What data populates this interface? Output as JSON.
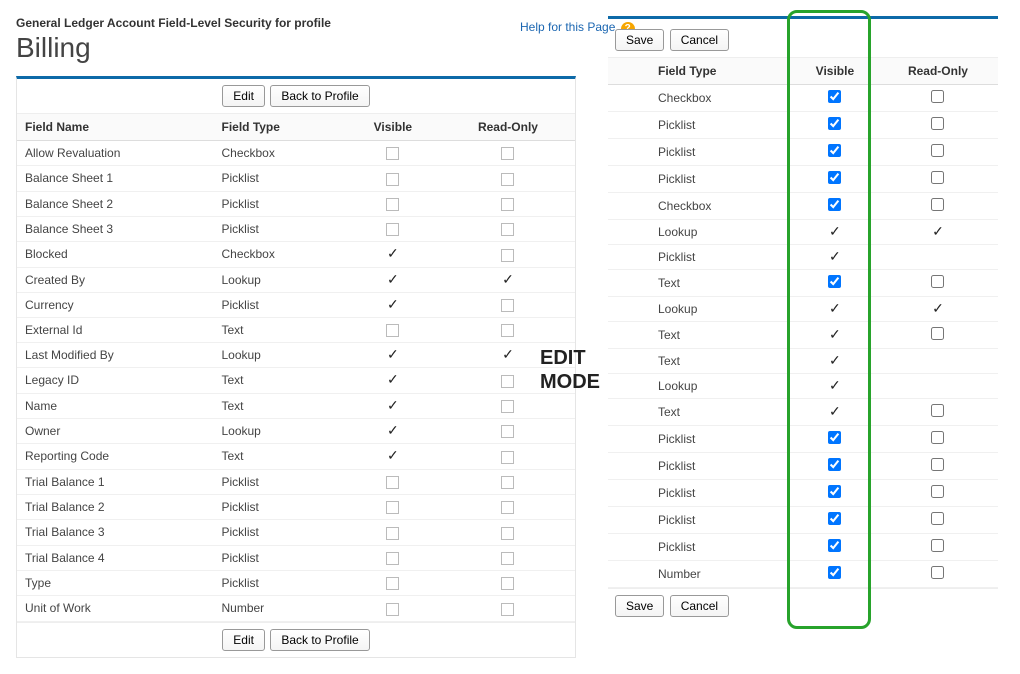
{
  "breadcrumb": "General Ledger Account Field-Level Security for profile",
  "page_title": "Billing",
  "help": {
    "label": "Help for this Page",
    "icon_text": "?"
  },
  "buttons": {
    "edit": "Edit",
    "back": "Back to Profile",
    "save": "Save",
    "cancel": "Cancel"
  },
  "headers": {
    "field_name": "Field Name",
    "field_type": "Field Type",
    "visible": "Visible",
    "read_only": "Read-Only"
  },
  "edit_mode_label": "EDIT MODE",
  "view_rows": [
    {
      "name": "Allow Revaluation",
      "type": "Checkbox",
      "visible": false,
      "readonly": false
    },
    {
      "name": "Balance Sheet 1",
      "type": "Picklist",
      "visible": false,
      "readonly": false
    },
    {
      "name": "Balance Sheet 2",
      "type": "Picklist",
      "visible": false,
      "readonly": false
    },
    {
      "name": "Balance Sheet 3",
      "type": "Picklist",
      "visible": false,
      "readonly": false
    },
    {
      "name": "Blocked",
      "type": "Checkbox",
      "visible": true,
      "readonly": false
    },
    {
      "name": "Created By",
      "type": "Lookup",
      "visible": true,
      "readonly": true
    },
    {
      "name": "Currency",
      "type": "Picklist",
      "visible": true,
      "readonly": false
    },
    {
      "name": "External Id",
      "type": "Text",
      "visible": false,
      "readonly": false
    },
    {
      "name": "Last Modified By",
      "type": "Lookup",
      "visible": true,
      "readonly": true
    },
    {
      "name": "Legacy ID",
      "type": "Text",
      "visible": true,
      "readonly": false
    },
    {
      "name": "Name",
      "type": "Text",
      "visible": true,
      "readonly": false
    },
    {
      "name": "Owner",
      "type": "Lookup",
      "visible": true,
      "readonly": false
    },
    {
      "name": "Reporting Code",
      "type": "Text",
      "visible": true,
      "readonly": false
    },
    {
      "name": "Trial Balance 1",
      "type": "Picklist",
      "visible": false,
      "readonly": false
    },
    {
      "name": "Trial Balance 2",
      "type": "Picklist",
      "visible": false,
      "readonly": false
    },
    {
      "name": "Trial Balance 3",
      "type": "Picklist",
      "visible": false,
      "readonly": false
    },
    {
      "name": "Trial Balance 4",
      "type": "Picklist",
      "visible": false,
      "readonly": false
    },
    {
      "name": "Type",
      "type": "Picklist",
      "visible": false,
      "readonly": false
    },
    {
      "name": "Unit of Work",
      "type": "Number",
      "visible": false,
      "readonly": false
    }
  ],
  "edit_rows": [
    {
      "type": "Checkbox",
      "visible_kind": "checkbox",
      "visible": true,
      "readonly_kind": "checkbox",
      "readonly": false
    },
    {
      "type": "Picklist",
      "visible_kind": "checkbox",
      "visible": true,
      "readonly_kind": "checkbox",
      "readonly": false
    },
    {
      "type": "Picklist",
      "visible_kind": "checkbox",
      "visible": true,
      "readonly_kind": "checkbox",
      "readonly": false
    },
    {
      "type": "Picklist",
      "visible_kind": "checkbox",
      "visible": true,
      "readonly_kind": "checkbox",
      "readonly": false
    },
    {
      "type": "Checkbox",
      "visible_kind": "checkbox",
      "visible": true,
      "readonly_kind": "checkbox",
      "readonly": false
    },
    {
      "type": "Lookup",
      "visible_kind": "check",
      "visible": true,
      "readonly_kind": "check",
      "readonly": true
    },
    {
      "type": "Picklist",
      "visible_kind": "check",
      "visible": true,
      "readonly_kind": "blank",
      "readonly": false
    },
    {
      "type": "Text",
      "visible_kind": "checkbox",
      "visible": true,
      "readonly_kind": "checkbox",
      "readonly": false
    },
    {
      "type": "Lookup",
      "visible_kind": "check",
      "visible": true,
      "readonly_kind": "check",
      "readonly": true
    },
    {
      "type": "Text",
      "visible_kind": "check",
      "visible": true,
      "readonly_kind": "checkbox",
      "readonly": false
    },
    {
      "type": "Text",
      "visible_kind": "check",
      "visible": true,
      "readonly_kind": "blank",
      "readonly": false
    },
    {
      "type": "Lookup",
      "visible_kind": "check",
      "visible": true,
      "readonly_kind": "blank",
      "readonly": false
    },
    {
      "type": "Text",
      "visible_kind": "check",
      "visible": true,
      "readonly_kind": "checkbox",
      "readonly": false
    },
    {
      "type": "Picklist",
      "visible_kind": "checkbox",
      "visible": true,
      "readonly_kind": "checkbox",
      "readonly": false
    },
    {
      "type": "Picklist",
      "visible_kind": "checkbox",
      "visible": true,
      "readonly_kind": "checkbox",
      "readonly": false
    },
    {
      "type": "Picklist",
      "visible_kind": "checkbox",
      "visible": true,
      "readonly_kind": "checkbox",
      "readonly": false
    },
    {
      "type": "Picklist",
      "visible_kind": "checkbox",
      "visible": true,
      "readonly_kind": "checkbox",
      "readonly": false
    },
    {
      "type": "Picklist",
      "visible_kind": "checkbox",
      "visible": true,
      "readonly_kind": "checkbox",
      "readonly": false
    },
    {
      "type": "Number",
      "visible_kind": "checkbox",
      "visible": true,
      "readonly_kind": "checkbox",
      "readonly": false
    }
  ]
}
